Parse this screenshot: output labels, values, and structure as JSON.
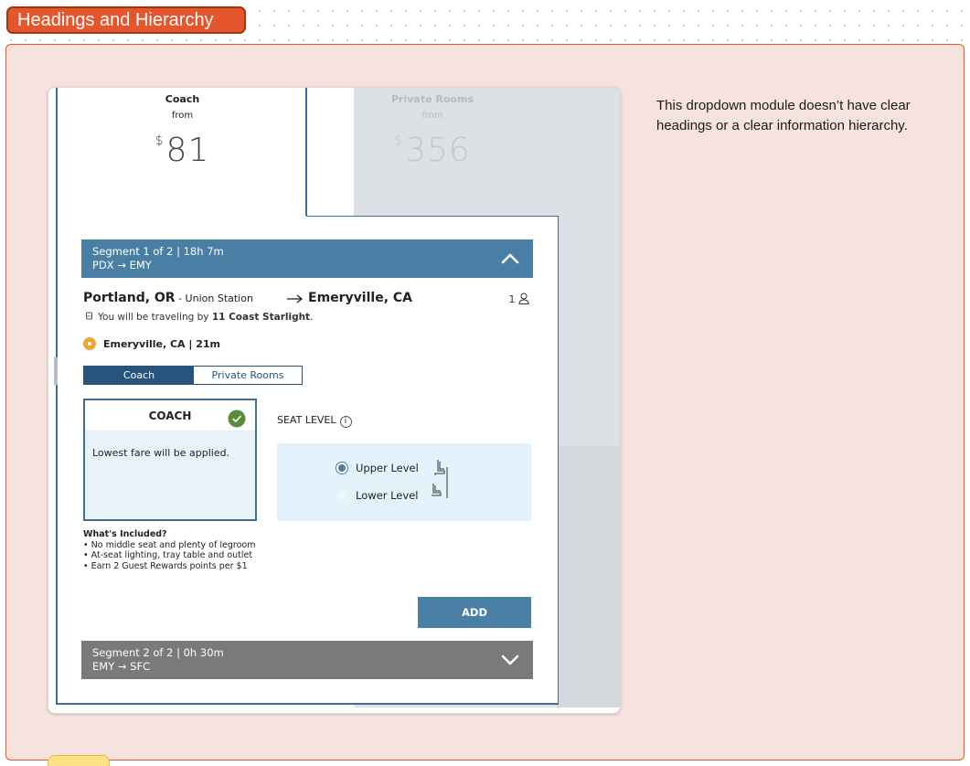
{
  "board": {
    "title": "Headings and Hierarchy",
    "note": "This dropdown module doesn’t have clear headings or a clear information hierarchy."
  },
  "fares": [
    {
      "name": "Coach",
      "from": "from",
      "currency": "$",
      "price": "81"
    },
    {
      "name": "Private Rooms",
      "from": "from",
      "currency": "$",
      "price": "356"
    }
  ],
  "segment1": {
    "summary": "Segment 1 of 2 | 18h 7m",
    "route": "PDX → EMY"
  },
  "trip": {
    "from_city": "Portland, OR",
    "from_station": " - Union Station",
    "to_city": "Emeryville, CA",
    "passengers": "1",
    "train_prefix": "You will be traveling by ",
    "train_name": "11 Coast Starlight",
    "train_suffix": ".",
    "stop": "Emeryville, CA | 21m"
  },
  "toggle": {
    "selected": "Coach",
    "other": "Private Rooms"
  },
  "coach_card": {
    "title": "COACH",
    "body": "Lowest fare will be applied."
  },
  "included": {
    "title": "What's Included?",
    "items": [
      "No middle seat and plenty of legroom",
      "At-seat lighting, tray table and outlet",
      "Earn 2 Guest Rewards points per $1"
    ]
  },
  "seat": {
    "label": "SEAT LEVEL",
    "info": "i",
    "options": [
      "Upper Level",
      "Lower Level"
    ],
    "selected": "Upper Level"
  },
  "add_label": "ADD",
  "segment2": {
    "summary": "Segment 2 of 2 | 0h 30m",
    "route": "EMY → SFC"
  },
  "colors": {
    "accent": "#e5562c",
    "section_bg": "#f7e3de",
    "segment_blue": "#4a7fa5",
    "segment_gray": "#7a7a7a",
    "toggle_navy": "#26547c",
    "stop_orange": "#f0a437",
    "check_green": "#5b8c3a"
  }
}
